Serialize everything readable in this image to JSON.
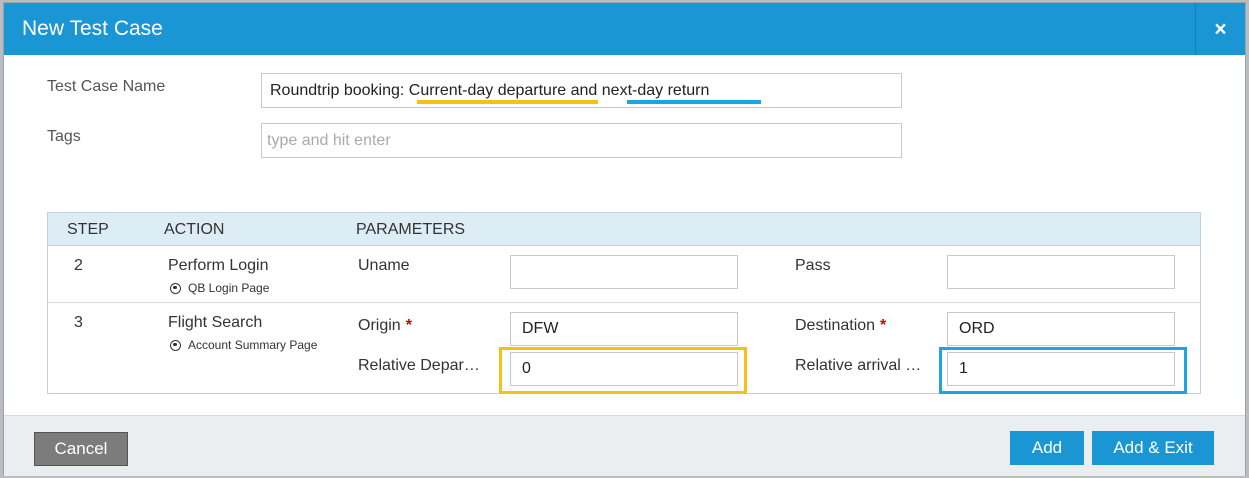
{
  "dialog": {
    "title": "New Test Case",
    "close_label": "×"
  },
  "form": {
    "name_label": "Test Case Name",
    "name_part1": "Roundtrip booking: ",
    "name_part2": "Current-day departure",
    "name_part3": " and ",
    "name_part4": "next-day return",
    "tags_label": "Tags",
    "tags_placeholder": "type and hit enter"
  },
  "highlight_colors": {
    "departure": "#f5c116",
    "return": "#1ba5e6"
  },
  "steps_table": {
    "headers": {
      "step": "STEP",
      "action": "ACTION",
      "parameters": "PARAMETERS"
    },
    "rows": [
      {
        "step": "2",
        "action": "Perform Login",
        "page": "QB Login Page",
        "p1_label": "Uname",
        "p1_value": "",
        "p2_label": "Pass",
        "p2_value": ""
      },
      {
        "step": "3",
        "action": "Flight Search",
        "page": "Account Summary Page",
        "p1_label": "Origin",
        "p1_required": "*",
        "p1_value": "DFW",
        "p2_label": "Destination",
        "p2_required": "*",
        "p2_value": "ORD",
        "p3_label": "Relative Depar…",
        "p3_value": "0",
        "p4_label": "Relative arrival …",
        "p4_value": "1"
      }
    ]
  },
  "footer": {
    "cancel_label": "Cancel",
    "add_label": "Add",
    "add_exit_label": "Add & Exit"
  }
}
